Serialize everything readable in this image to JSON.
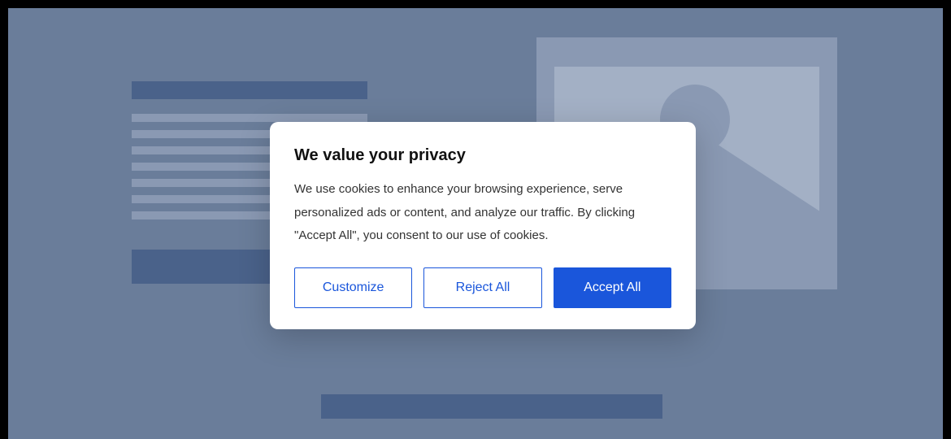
{
  "modal": {
    "title": "We value your privacy",
    "description": "We use cookies to enhance your browsing experience, serve personalized ads or content, and analyze our traffic. By clicking \"Accept All\", you consent to our use of cookies.",
    "buttons": {
      "customize": "Customize",
      "reject": "Reject All",
      "accept": "Accept All"
    }
  }
}
